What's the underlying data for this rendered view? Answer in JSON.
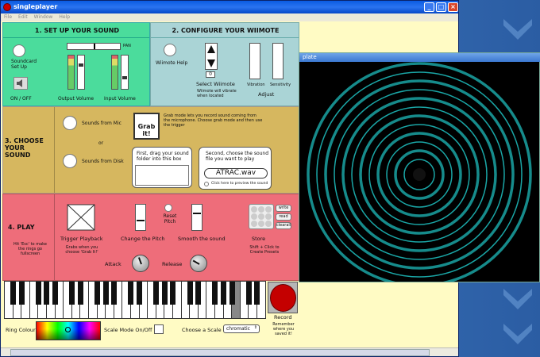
{
  "window": {
    "title": "singleplayer",
    "menus": [
      "File",
      "Edit",
      "Window",
      "Help"
    ]
  },
  "sound": {
    "heading": "1.  SET UP YOUR SOUND",
    "pan": "PAN",
    "soundcard": "Soundcard Set Up",
    "onoff": "ON / OFF",
    "output": "Output Volume",
    "input": "Input Volume"
  },
  "wiimote": {
    "heading": "2.  CONFIGURE YOUR WIIMOTE",
    "help": "Wiimote Help",
    "select": "Select Wiimote",
    "index": "0",
    "note": "Wiimote will vibrate when located",
    "vibration": "Vibration",
    "sensitivity": "Sensitivity",
    "adjust": "Adjust"
  },
  "choose": {
    "heading": "3.  CHOOSE YOUR SOUND",
    "mic": "Sounds from Mic",
    "or": "or",
    "disk": "Sounds from Disk",
    "grab": "Grab it!",
    "grab_note": "Grab mode lets you record sound coming from the microphone. Choose grab mode and then use the trigger",
    "first": "First, drag your sound folder into this box",
    "second": "Second, choose the sound file you want to play",
    "file": "ATRAC.wav",
    "preview": "Click here to preview the sound"
  },
  "play": {
    "heading": "4.  PLAY",
    "esc": "Hit 'Esc' to make the rings go fullscreen",
    "trigger": "Trigger Playback",
    "trigger_note": "Grabs when you choose 'Grab It!'",
    "pitch": "Change the Pitch",
    "reset": "Reset Pitch",
    "smooth": "Smooth the sound",
    "store": "Store",
    "store_note": "Shift + Click to Create Presets",
    "write": "write",
    "read": "read",
    "clear": "clearall",
    "attack": "Attack",
    "release": "Release"
  },
  "bottom": {
    "ring": "Ring Colour",
    "scalemode": "Scale Mode On/Off",
    "choose_scale": "Choose a Scale",
    "scale": "chromatic",
    "record": "Record",
    "remember": "Remember where you saved it!"
  },
  "plate": {
    "title": "plate",
    "colors": {
      "ring": "#1aa6a6",
      "bg": "#000000"
    }
  }
}
